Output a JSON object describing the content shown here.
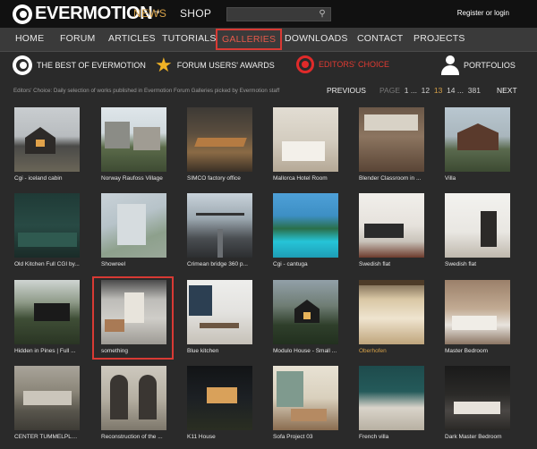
{
  "header": {
    "logo_text": "EVERMOTION",
    "logo_tm": "™",
    "top_nav": [
      "NEWS",
      "SHOP"
    ],
    "search_placeholder": "",
    "login_text": "Register or login"
  },
  "main_nav": {
    "items": [
      "HOME",
      "FORUM",
      "ARTICLES",
      "TUTORIALS",
      "GALLERIES",
      "DOWNLOADS",
      "CONTACT",
      "PROJECTS"
    ],
    "active": "GALLERIES"
  },
  "categories": [
    {
      "label": "THE BEST OF EVERMOTION",
      "icon": "evermotion-logo-icon"
    },
    {
      "label": "FORUM USERS' AWARDS",
      "icon": "star-icon"
    },
    {
      "label": "EDITORS' CHOICE",
      "icon": "target-icon"
    },
    {
      "label": "PORTFOLIOS",
      "icon": "person-icon"
    }
  ],
  "info_text": "Editors' Choice: Daily selection of works published in Evermotion Forum Galleries picked by Evermotion staff",
  "pager": {
    "prev": "PREVIOUS",
    "label": "PAGE",
    "pages": [
      "1",
      "...",
      "12",
      "13",
      "14",
      "...",
      "381"
    ],
    "current": "13",
    "next": "NEXT"
  },
  "gallery": [
    {
      "caption": "Cgi - iceland cabin"
    },
    {
      "caption": "Norway Raufoss Village"
    },
    {
      "caption": "SIMCO factory office"
    },
    {
      "caption": "Mallorca Hotel Room"
    },
    {
      "caption": "Blender Classroom in ..."
    },
    {
      "caption": "Villa"
    },
    {
      "caption": "Old Kitchen Full CGI by..."
    },
    {
      "caption": "Showreel"
    },
    {
      "caption": "Crimean bridge 360 p..."
    },
    {
      "caption": "Cgi - cantuga"
    },
    {
      "caption": "Swedish flat"
    },
    {
      "caption": "Swedish flat"
    },
    {
      "caption": "Hidden in Pines | Full ..."
    },
    {
      "caption": "something"
    },
    {
      "caption": "Blue kitchen"
    },
    {
      "caption": "Modulo House - Small ..."
    },
    {
      "caption": "Oberhofen"
    },
    {
      "caption": "Master Bedroom"
    },
    {
      "caption": "CENTER TUMMELPLAT..."
    },
    {
      "caption": "Reconstruction of the ..."
    },
    {
      "caption": "K11 House"
    },
    {
      "caption": "Sofa Project 03"
    },
    {
      "caption": "French villa"
    },
    {
      "caption": "Dark Master Bedroom"
    }
  ],
  "colors": {
    "accent_orange": "#d5a048",
    "highlight_red": "#d83a34"
  }
}
